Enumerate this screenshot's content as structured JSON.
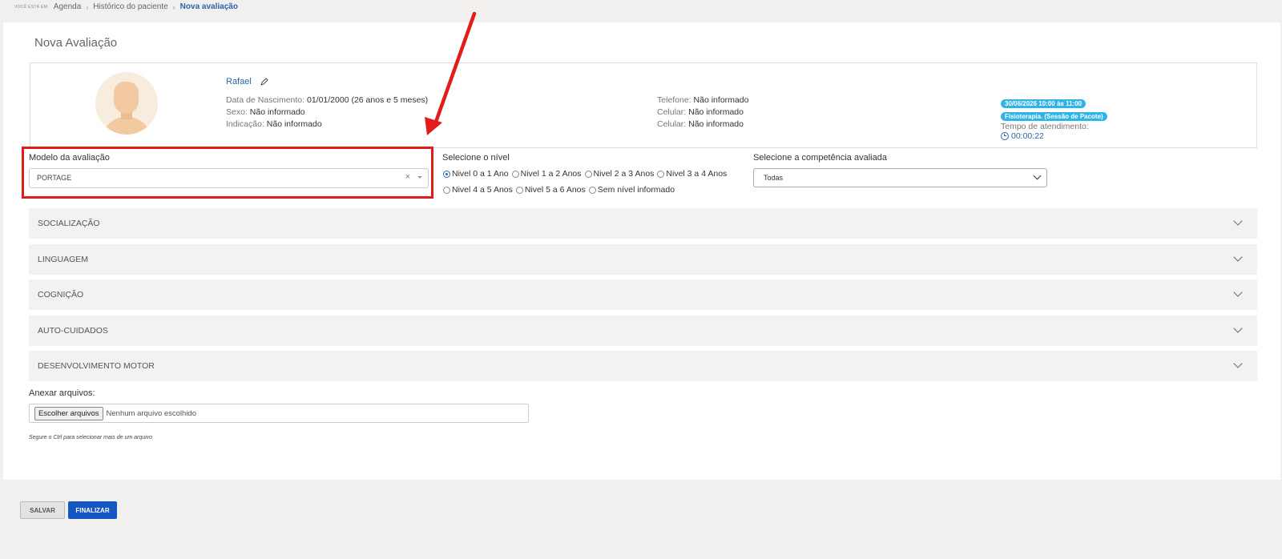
{
  "breadcrumb": {
    "prefix": "Você está em:",
    "items": [
      "Agenda",
      "Histórico do paciente"
    ],
    "current": "Nova avaliação"
  },
  "page_title": "Nova Avaliação",
  "patient": {
    "name": "Rafael",
    "birth_label": "Data de Nascimento:",
    "birth_value": "01/01/2000 (26 anos e 5 meses)",
    "sex_label": "Sexo:",
    "sex_value": "Não informado",
    "referral_label": "Indicação:",
    "referral_value": "Não informado",
    "phone_label": "Telefone:",
    "phone_value": "Não informado",
    "cell1_label": "Celular:",
    "cell1_value": "Não informado",
    "cell2_label": "Celular:",
    "cell2_value": "Não informado",
    "appointment_badge": "30/06/2026 10:00 às 11:00",
    "service_badge": "Fisioterapia. (Sessão de Pacote)",
    "service_time_label": "Tempo de atendimento:",
    "service_time_value": "00:00:22"
  },
  "model": {
    "label": "Modelo da avaliação",
    "value": "PORTAGE",
    "clear": "×"
  },
  "level": {
    "label": "Selecione o nível",
    "options": [
      "Nivel 0 a 1 Ano",
      "Nivel 1 a 2 Anos",
      "Nivel 2 a 3 Anos",
      "Nivel 3 a 4 Anos",
      "Nivel 4 a 5 Anos",
      "Nivel 5 a 6 Anos",
      "Sem nível informado"
    ],
    "selected": "Nivel 0 a 1 Ano"
  },
  "competence": {
    "label": "Selecione a competência avaliada",
    "value": "Todas"
  },
  "sections": [
    "SOCIALIZAÇÃO",
    "LINGUAGEM",
    "COGNIÇÃO",
    "AUTO-CUIDADOS",
    "DESENVOLVIMENTO MOTOR"
  ],
  "attachments": {
    "label": "Anexar arquivos:",
    "button": "Escolher arquivos",
    "status": "Nenhum arquivo escolhido",
    "hint": "Segure o Ctrl para selecionar mais de um arquivo"
  },
  "actions": {
    "save": "SALVAR",
    "finish": "FINALIZAR"
  },
  "annotation_color": "#e21b1b"
}
